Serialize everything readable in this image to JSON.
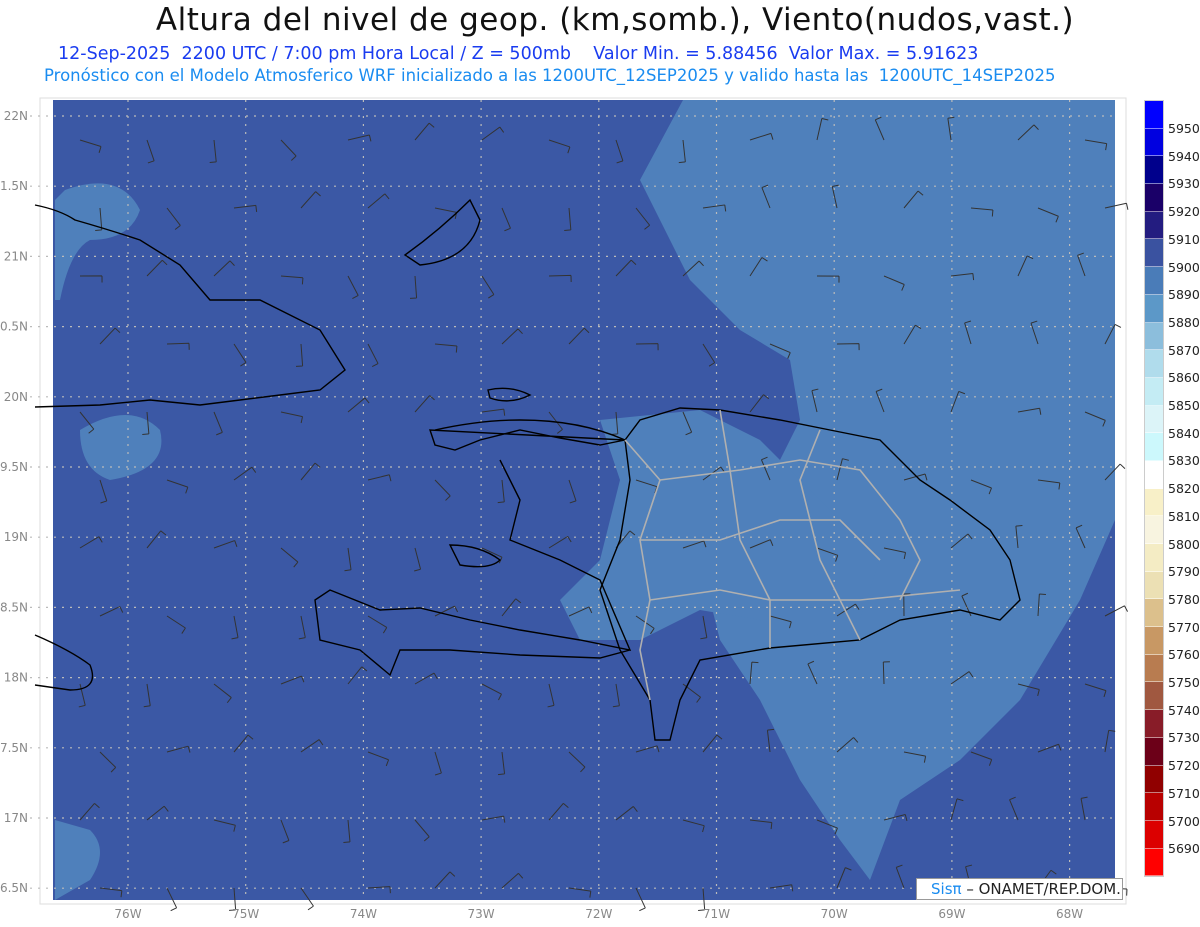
{
  "header": {
    "title": "Altura del nivel de geop. (km,somb.), Viento(nudos,vast.)",
    "subtitle_line1": "12-Sep-2025  2200 UTC / 7:00 pm Hora Local / Z = 500mb    Valor Min. = 5.88456  Valor Max. = 5.91623",
    "subtitle_line2": "Pronóstico con el Modelo Atmosferico WRF inicializado a las 1200UTC_12SEP2025 y valido hasta las  1200UTC_14SEP2025"
  },
  "map": {
    "background_color": "#3b58a5",
    "light_color": "#4f80bb",
    "lon_labels": [
      "76W",
      "75W",
      "74W",
      "73W",
      "72W",
      "71W",
      "70W",
      "69W",
      "68W"
    ],
    "lat_labels": [
      "22N",
      "1.5N",
      "21N",
      "0.5N",
      "20N",
      "9.5N",
      "19N",
      "8.5N",
      "18N",
      "7.5N",
      "17N",
      "6.5N"
    ]
  },
  "colorbar": {
    "labels": [
      "5950",
      "5940",
      "5930",
      "5920",
      "5910",
      "5900",
      "5890",
      "5880",
      "5870",
      "5860",
      "5850",
      "5840",
      "5830",
      "5820",
      "5810",
      "5800",
      "5790",
      "5780",
      "5770",
      "5760",
      "5750",
      "5740",
      "5730",
      "5720",
      "5710",
      "5700",
      "5690"
    ],
    "colors": [
      "#0000ff",
      "#0000e0",
      "#00008c",
      "#1a0068",
      "#231c80",
      "#3a52a0",
      "#4a7cb8",
      "#5c98c8",
      "#8cbedc",
      "#b0dcec",
      "#c4ecf4",
      "#dcf4f8",
      "#ccf8fc",
      "#ffffff",
      "#f8f0c8",
      "#f8f4e0",
      "#f4ecc4",
      "#ece0b4",
      "#dcc08c",
      "#c89864",
      "#b87c50",
      "#a05840",
      "#881c28",
      "#6c0018",
      "#900000",
      "#b80000",
      "#dc0000",
      "#ff0000"
    ]
  },
  "credit": {
    "sis": "Sisπ",
    "org": " – ONAMET/REP.DOM."
  }
}
